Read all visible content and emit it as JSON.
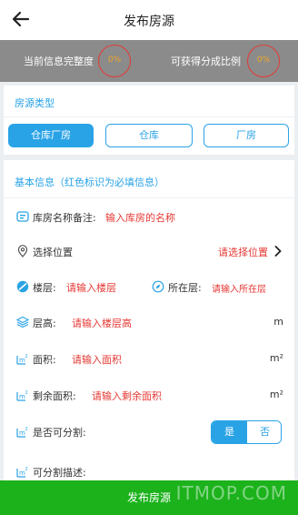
{
  "header": {
    "title": "发布房源"
  },
  "stats": {
    "completeness_label": "当前信息完整度",
    "completeness_value": "0%",
    "share_label": "可获得分成比例",
    "share_value": "0%"
  },
  "property_type": {
    "section_title": "房源类型",
    "options": [
      {
        "label": "仓库厂房",
        "active": true
      },
      {
        "label": "仓库",
        "active": false
      },
      {
        "label": "厂房",
        "active": false
      }
    ]
  },
  "basic_info": {
    "section_title": "基本信息（红色标识为必填信息）",
    "name_note": {
      "label": "库房名称备注:",
      "placeholder": "输入库房的名称"
    },
    "location": {
      "label": "选择位置",
      "placeholder": "请选择位置"
    },
    "floors": {
      "label": "楼层:",
      "placeholder": "请输入楼层"
    },
    "current_floor": {
      "label": "所在层:",
      "placeholder": "请输入所在层"
    },
    "floor_height": {
      "label": "层高:",
      "placeholder": "请输入楼层高",
      "unit": "m"
    },
    "area": {
      "label": "面积:",
      "placeholder": "请输入面积",
      "unit": "m²"
    },
    "remaining_area": {
      "label": "剩余面积:",
      "placeholder": "请输入剩余面积",
      "unit": "m²"
    },
    "divisible": {
      "label": "是否可分割:",
      "yes": "是",
      "no": "否",
      "selected": "是"
    },
    "division_desc": {
      "label": "可分割描述:"
    }
  },
  "submit_label": "发布房源",
  "watermark": "ITMOP.COM",
  "icons": [
    "back-arrow-icon",
    "tag-icon",
    "location-pin-icon",
    "floor-icon",
    "compass-icon",
    "layers-icon",
    "area-icon",
    "chevron-right-icon"
  ],
  "colors": {
    "accent": "#29a3e6",
    "required": "#e53935",
    "submit": "#1cb21c",
    "stat_bar": "#8b8b8b"
  }
}
